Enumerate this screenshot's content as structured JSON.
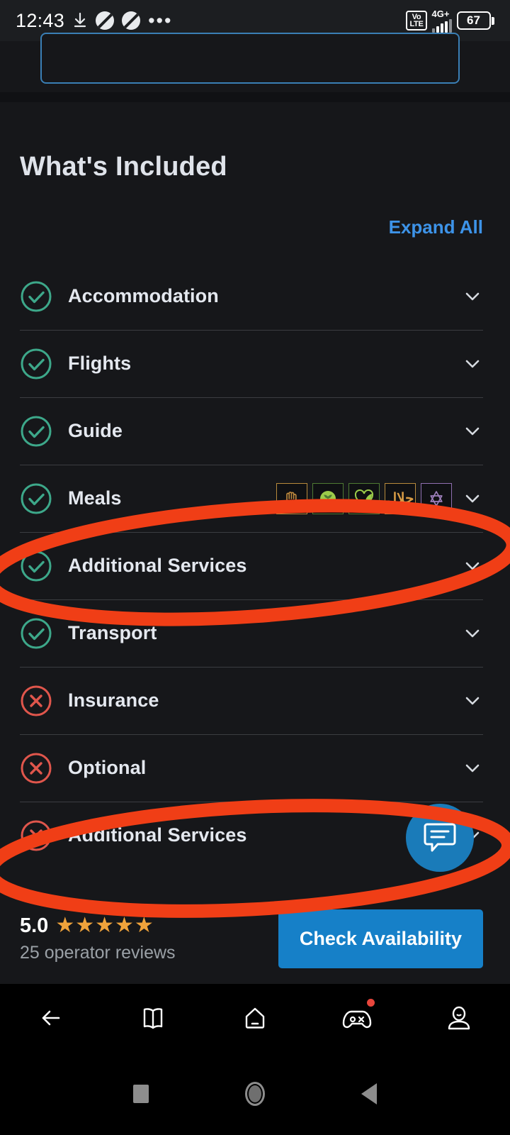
{
  "statusbar": {
    "time": "12:43",
    "download_icon": "download-icon",
    "blocked_icon_1": "circle-slash-icon",
    "blocked_icon_2": "circle-slash-icon",
    "more_icon": "ellipsis-icon",
    "volte": "VoLTE",
    "volte_line1": "Vo",
    "volte_line2": "LTE",
    "network": "4G+",
    "battery_percent": "67"
  },
  "top_card": {
    "input_value": "",
    "input_placeholder": ""
  },
  "main": {
    "title": "What's Included",
    "expand_all_label": "Expand All",
    "items": [
      {
        "label": "Accommodation",
        "status": "included",
        "icon": "check-circle-icon",
        "chevron": "chevron-down-icon"
      },
      {
        "label": "Flights",
        "status": "included",
        "icon": "check-circle-icon",
        "chevron": "chevron-down-icon"
      },
      {
        "label": "Guide",
        "status": "included",
        "icon": "check-circle-icon",
        "chevron": "chevron-down-icon"
      },
      {
        "label": "Meals",
        "status": "included",
        "icon": "check-circle-icon",
        "chevron": "chevron-down-icon"
      },
      {
        "label": "Additional Services",
        "status": "included",
        "icon": "check-circle-icon",
        "chevron": "chevron-down-icon"
      },
      {
        "label": "Transport",
        "status": "included",
        "icon": "check-circle-icon",
        "chevron": "chevron-down-icon"
      },
      {
        "label": "Insurance",
        "status": "excluded",
        "icon": "x-circle-icon",
        "chevron": "chevron-down-icon"
      },
      {
        "label": "Optional",
        "status": "excluded",
        "icon": "x-circle-icon",
        "chevron": "chevron-down-icon"
      },
      {
        "label": "Additional Services",
        "status": "excluded",
        "icon": "x-circle-icon",
        "chevron": "chevron-down-icon"
      }
    ],
    "diet_badges": [
      {
        "name": "hand-icon",
        "label": "",
        "color": "#c08a3e"
      },
      {
        "name": "leaf-circle-icon",
        "label": "",
        "color": "#8cc63f"
      },
      {
        "name": "heart-leaf-icon",
        "label": "",
        "color": "#8cc63f"
      },
      {
        "name": "halal-icon",
        "label": "حلال",
        "color": "#d79b45"
      },
      {
        "name": "kosher-star-icon",
        "label": "KOSHER",
        "color": "#9d7fbb"
      }
    ]
  },
  "chat_fab": {
    "name": "chat-bubble-icon"
  },
  "bottom_bar": {
    "rating_value": "5.0",
    "stars": "★★★★★",
    "star_count": 5,
    "review_count_text": "25 operator reviews",
    "cta_label": "Check Availability"
  },
  "app_nav": {
    "items": [
      {
        "name": "back-arrow-icon",
        "badge": false
      },
      {
        "name": "book-icon",
        "badge": false
      },
      {
        "name": "home-icon",
        "badge": false
      },
      {
        "name": "game-controller-icon",
        "badge": true
      },
      {
        "name": "profile-icon",
        "badge": false
      }
    ]
  },
  "system_nav": {
    "recents": "recents-square-icon",
    "home": "home-circle-icon",
    "back": "back-triangle-icon"
  },
  "annotations": {
    "color": "#f03e16",
    "shapes": [
      {
        "name": "highlight-ellipse-additional-services-included"
      },
      {
        "name": "highlight-ellipse-additional-services-excluded"
      }
    ]
  },
  "colors": {
    "included": "#3da88a",
    "excluded": "#e0564c",
    "accent_blue": "#3d93e8",
    "cta_blue": "#1680c8",
    "star": "#f0a33b",
    "annotation_red": "#f03e16"
  }
}
